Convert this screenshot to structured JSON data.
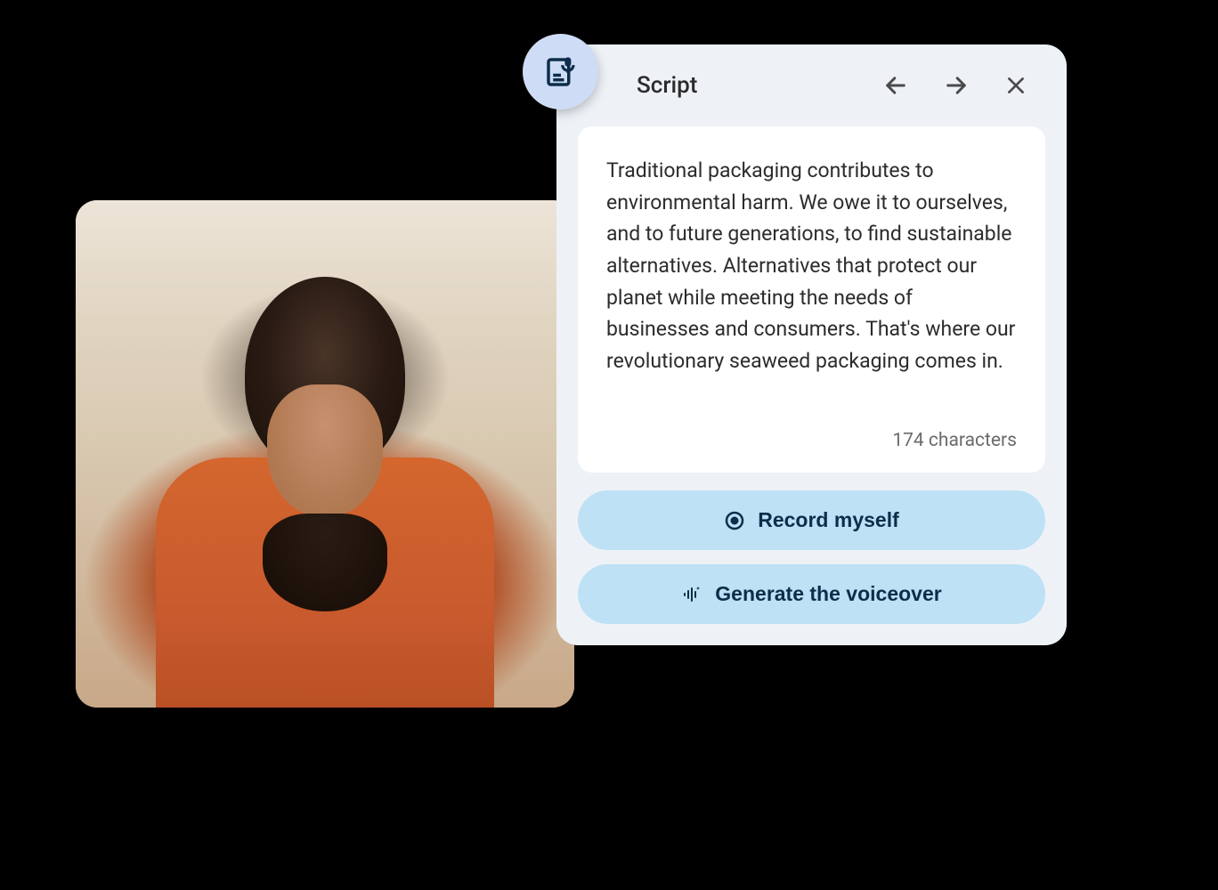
{
  "panel": {
    "title": "Script",
    "icon": "script-mic-icon"
  },
  "script": {
    "text": "Traditional packaging contributes to environmental harm. We owe it to ourselves, and to future generations, to find sustainable alternatives. Alternatives that protect our planet while meeting the needs of businesses and consumers. That's where our revolutionary seaweed packaging comes in.",
    "character_count": "174 characters"
  },
  "actions": {
    "record_label": "Record myself",
    "generate_label": "Generate the voiceover"
  },
  "colors": {
    "panel_bg": "#eef2f7",
    "icon_bg": "#cfdcf5",
    "button_bg": "#bee1f5",
    "button_text": "#0d2e4a"
  }
}
